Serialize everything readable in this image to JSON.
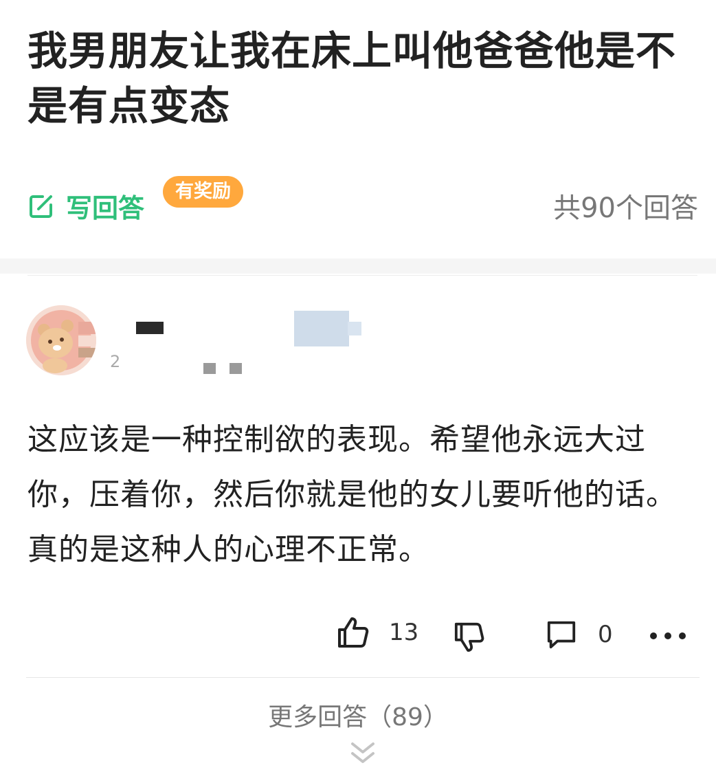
{
  "question": {
    "title": "我男朋友让我在床上叫他爸爸他是不是有点变态"
  },
  "actions": {
    "write_answer_label": "写回答",
    "reward_badge": "有奖励",
    "answer_count": "共90个回答"
  },
  "answer": {
    "text": "这应该是一种控制欲的表现。希望他永远大过你，压着你，然后你就是他的女儿要听他的话。真的是这种人的心理不正常。",
    "author_partial": "2",
    "like_count": "13",
    "comment_count": "0"
  },
  "more": {
    "label": "更多回答（89）"
  },
  "colors": {
    "accent_green": "#2fbf7a",
    "badge_orange": "#ffa83d"
  },
  "icons": {
    "write": "edit-icon",
    "like": "thumbs-up-icon",
    "dislike": "thumbs-down-icon",
    "comment": "comment-icon",
    "more": "more-dots-icon",
    "expand": "chevron-double-down-icon"
  }
}
